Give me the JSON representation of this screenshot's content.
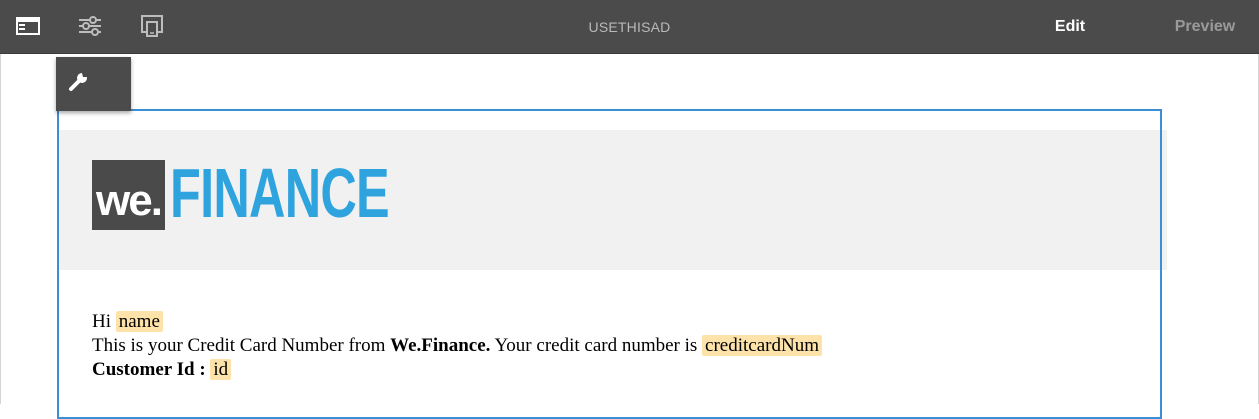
{
  "toolbar": {
    "title": "USETHISAD",
    "edit_label": "Edit",
    "preview_label": "Preview",
    "icons": [
      "side-panel-icon",
      "properties-icon",
      "emulator-icon"
    ]
  },
  "component_toolbar": {
    "icon": "wrench-icon"
  },
  "email": {
    "logo": {
      "prefix": "we.",
      "brand": "FINANCE"
    },
    "greeting": "Hi",
    "name_token": "name",
    "line2_prefix": "This is your Credit Card Number from",
    "line2_brand": "We.Finance.",
    "line2_suffix": "Your credit card number is",
    "card_token": "creditcardNum",
    "customer_label": "Customer Id :",
    "id_token": "id"
  },
  "colors": {
    "toolbar_bg": "#4b4b4b",
    "frame_border": "#3a8fd6",
    "logo_blue": "#2ea3dd",
    "token_highlight": "#fde2aa"
  }
}
